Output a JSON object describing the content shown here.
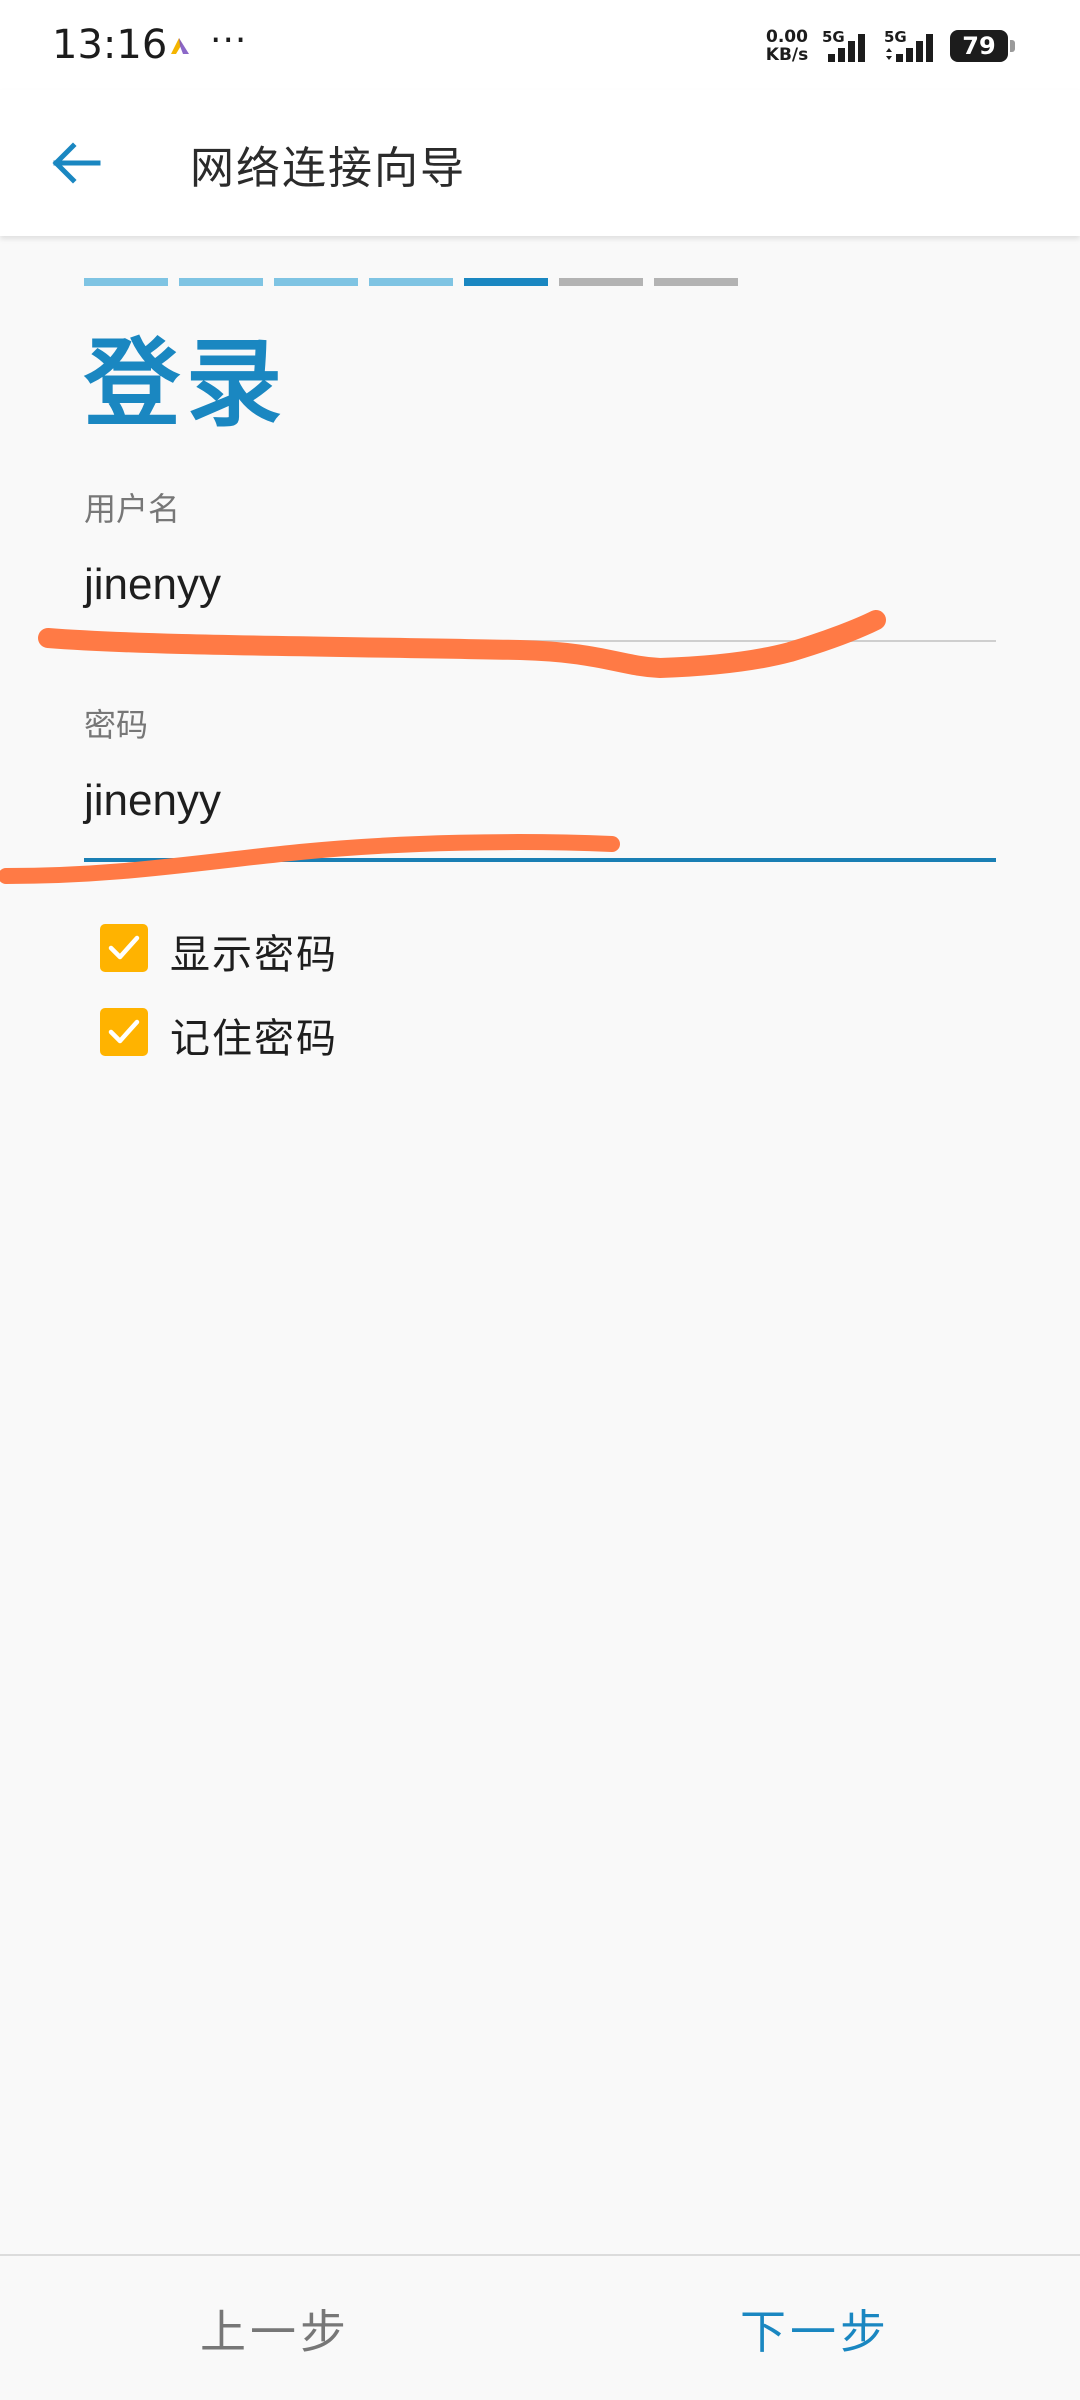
{
  "status_bar": {
    "time": "13:16",
    "more": "···",
    "net_speed_value": "0.00",
    "net_speed_unit": "KB/s",
    "signal1_label": "5G",
    "signal2_label": "5G",
    "battery": "79"
  },
  "app_bar": {
    "title": "网络连接向导",
    "back_icon": "arrow-left-icon"
  },
  "wizard": {
    "total_steps": 7,
    "current_step": 5,
    "colors": {
      "done": "#7fc4e3",
      "current": "#1a87c1",
      "pending": "#b3b3b3"
    }
  },
  "page": {
    "heading": "登录"
  },
  "form": {
    "username_label": "用户名",
    "username_value": "jinenyy",
    "password_label": "密码",
    "password_value": "jinenyy",
    "show_password_label": "显示密码",
    "show_password_checked": true,
    "remember_password_label": "记住密码",
    "remember_password_checked": true
  },
  "footer": {
    "prev_label": "上一步",
    "next_label": "下一步"
  },
  "colors": {
    "accent": "#1a87c1",
    "checkbox": "#ffb300",
    "redaction_scribble": "#ff7a45"
  }
}
